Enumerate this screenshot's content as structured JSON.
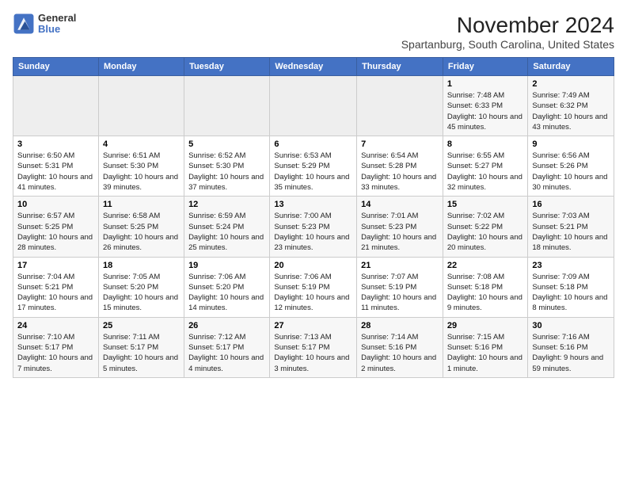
{
  "header": {
    "logo_line1": "General",
    "logo_line2": "Blue",
    "month_title": "November 2024",
    "location": "Spartanburg, South Carolina, United States"
  },
  "weekdays": [
    "Sunday",
    "Monday",
    "Tuesday",
    "Wednesday",
    "Thursday",
    "Friday",
    "Saturday"
  ],
  "weeks": [
    [
      {
        "day": "",
        "info": ""
      },
      {
        "day": "",
        "info": ""
      },
      {
        "day": "",
        "info": ""
      },
      {
        "day": "",
        "info": ""
      },
      {
        "day": "",
        "info": ""
      },
      {
        "day": "1",
        "info": "Sunrise: 7:48 AM\nSunset: 6:33 PM\nDaylight: 10 hours and 45 minutes."
      },
      {
        "day": "2",
        "info": "Sunrise: 7:49 AM\nSunset: 6:32 PM\nDaylight: 10 hours and 43 minutes."
      }
    ],
    [
      {
        "day": "3",
        "info": "Sunrise: 6:50 AM\nSunset: 5:31 PM\nDaylight: 10 hours and 41 minutes."
      },
      {
        "day": "4",
        "info": "Sunrise: 6:51 AM\nSunset: 5:30 PM\nDaylight: 10 hours and 39 minutes."
      },
      {
        "day": "5",
        "info": "Sunrise: 6:52 AM\nSunset: 5:30 PM\nDaylight: 10 hours and 37 minutes."
      },
      {
        "day": "6",
        "info": "Sunrise: 6:53 AM\nSunset: 5:29 PM\nDaylight: 10 hours and 35 minutes."
      },
      {
        "day": "7",
        "info": "Sunrise: 6:54 AM\nSunset: 5:28 PM\nDaylight: 10 hours and 33 minutes."
      },
      {
        "day": "8",
        "info": "Sunrise: 6:55 AM\nSunset: 5:27 PM\nDaylight: 10 hours and 32 minutes."
      },
      {
        "day": "9",
        "info": "Sunrise: 6:56 AM\nSunset: 5:26 PM\nDaylight: 10 hours and 30 minutes."
      }
    ],
    [
      {
        "day": "10",
        "info": "Sunrise: 6:57 AM\nSunset: 5:25 PM\nDaylight: 10 hours and 28 minutes."
      },
      {
        "day": "11",
        "info": "Sunrise: 6:58 AM\nSunset: 5:25 PM\nDaylight: 10 hours and 26 minutes."
      },
      {
        "day": "12",
        "info": "Sunrise: 6:59 AM\nSunset: 5:24 PM\nDaylight: 10 hours and 25 minutes."
      },
      {
        "day": "13",
        "info": "Sunrise: 7:00 AM\nSunset: 5:23 PM\nDaylight: 10 hours and 23 minutes."
      },
      {
        "day": "14",
        "info": "Sunrise: 7:01 AM\nSunset: 5:23 PM\nDaylight: 10 hours and 21 minutes."
      },
      {
        "day": "15",
        "info": "Sunrise: 7:02 AM\nSunset: 5:22 PM\nDaylight: 10 hours and 20 minutes."
      },
      {
        "day": "16",
        "info": "Sunrise: 7:03 AM\nSunset: 5:21 PM\nDaylight: 10 hours and 18 minutes."
      }
    ],
    [
      {
        "day": "17",
        "info": "Sunrise: 7:04 AM\nSunset: 5:21 PM\nDaylight: 10 hours and 17 minutes."
      },
      {
        "day": "18",
        "info": "Sunrise: 7:05 AM\nSunset: 5:20 PM\nDaylight: 10 hours and 15 minutes."
      },
      {
        "day": "19",
        "info": "Sunrise: 7:06 AM\nSunset: 5:20 PM\nDaylight: 10 hours and 14 minutes."
      },
      {
        "day": "20",
        "info": "Sunrise: 7:06 AM\nSunset: 5:19 PM\nDaylight: 10 hours and 12 minutes."
      },
      {
        "day": "21",
        "info": "Sunrise: 7:07 AM\nSunset: 5:19 PM\nDaylight: 10 hours and 11 minutes."
      },
      {
        "day": "22",
        "info": "Sunrise: 7:08 AM\nSunset: 5:18 PM\nDaylight: 10 hours and 9 minutes."
      },
      {
        "day": "23",
        "info": "Sunrise: 7:09 AM\nSunset: 5:18 PM\nDaylight: 10 hours and 8 minutes."
      }
    ],
    [
      {
        "day": "24",
        "info": "Sunrise: 7:10 AM\nSunset: 5:17 PM\nDaylight: 10 hours and 7 minutes."
      },
      {
        "day": "25",
        "info": "Sunrise: 7:11 AM\nSunset: 5:17 PM\nDaylight: 10 hours and 5 minutes."
      },
      {
        "day": "26",
        "info": "Sunrise: 7:12 AM\nSunset: 5:17 PM\nDaylight: 10 hours and 4 minutes."
      },
      {
        "day": "27",
        "info": "Sunrise: 7:13 AM\nSunset: 5:17 PM\nDaylight: 10 hours and 3 minutes."
      },
      {
        "day": "28",
        "info": "Sunrise: 7:14 AM\nSunset: 5:16 PM\nDaylight: 10 hours and 2 minutes."
      },
      {
        "day": "29",
        "info": "Sunrise: 7:15 AM\nSunset: 5:16 PM\nDaylight: 10 hours and 1 minute."
      },
      {
        "day": "30",
        "info": "Sunrise: 7:16 AM\nSunset: 5:16 PM\nDaylight: 9 hours and 59 minutes."
      }
    ]
  ]
}
